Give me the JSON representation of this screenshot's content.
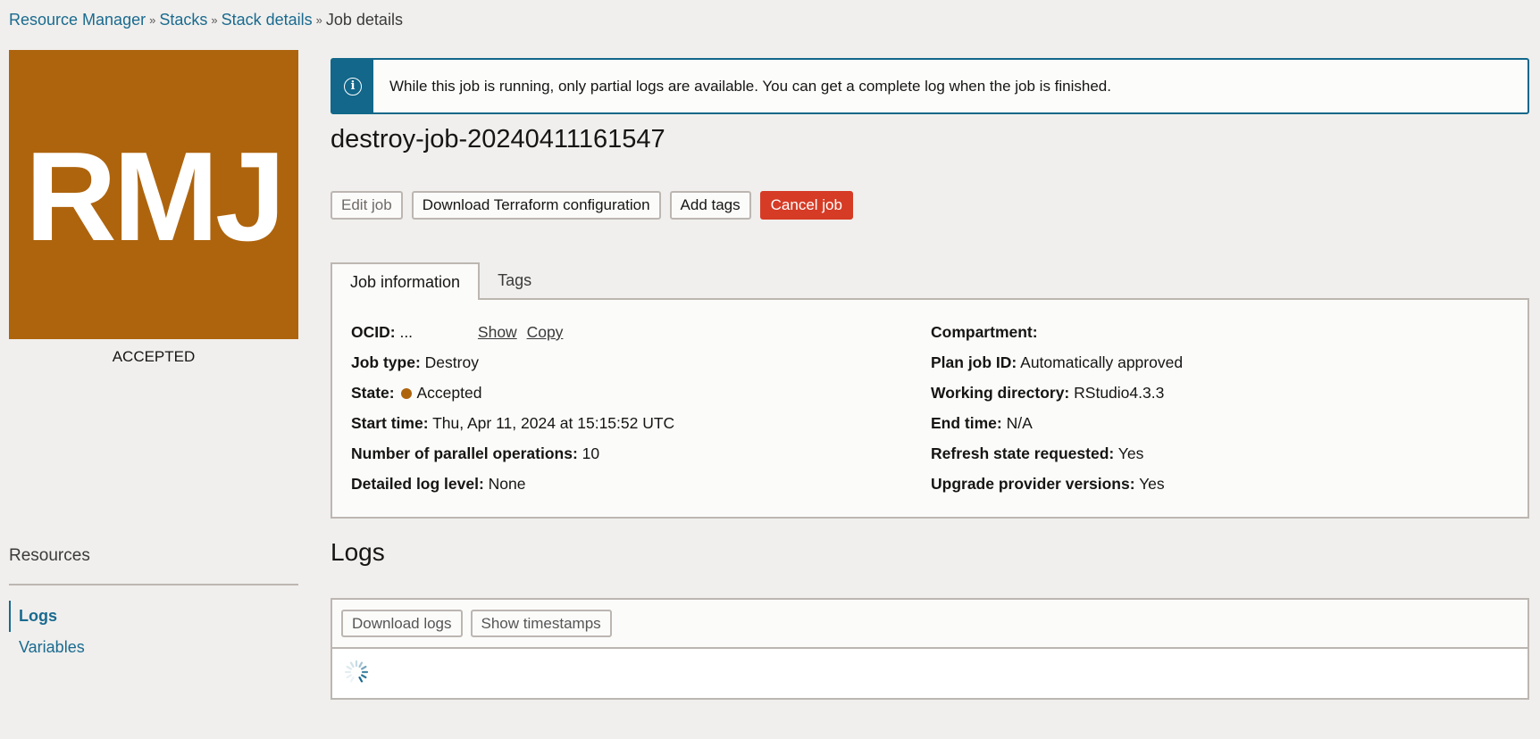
{
  "breadcrumb": [
    {
      "label": "Resource Manager",
      "link": true
    },
    {
      "label": "Stacks",
      "link": true
    },
    {
      "label": "Stack details",
      "link": true
    },
    {
      "label": "Job details",
      "link": false
    }
  ],
  "sidebar": {
    "avatar_initials": "RMJ",
    "avatar_color": "#ae640d",
    "status": "ACCEPTED",
    "resources_title": "Resources",
    "resources": [
      {
        "label": "Logs",
        "active": true
      },
      {
        "label": "Variables",
        "active": false
      }
    ]
  },
  "banner": {
    "icon": "info-icon",
    "text": "While this job is running, only partial logs are available. You can get a complete log when the job is finished."
  },
  "job": {
    "title": "destroy-job-20240411161547"
  },
  "actions": {
    "edit": "Edit job",
    "download_tf": "Download Terraform configuration",
    "add_tags": "Add tags",
    "cancel": "Cancel job"
  },
  "tabs": [
    {
      "label": "Job information",
      "active": true
    },
    {
      "label": "Tags",
      "active": false
    }
  ],
  "info": {
    "ocid": {
      "label": "OCID:",
      "value": "...",
      "show": "Show",
      "copy": "Copy"
    },
    "job_type": {
      "label": "Job type:",
      "value": "Destroy"
    },
    "state": {
      "label": "State:",
      "value": "Accepted",
      "color": "#ae640d"
    },
    "start_time": {
      "label": "Start time:",
      "value": "Thu, Apr 11, 2024 at 15:15:52 UTC"
    },
    "parallel_ops": {
      "label": "Number of parallel operations:",
      "value": "10"
    },
    "log_level": {
      "label": "Detailed log level:",
      "value": "None"
    },
    "compartment": {
      "label": "Compartment:",
      "value": ""
    },
    "plan_job_id": {
      "label": "Plan job ID:",
      "value": "Automatically approved"
    },
    "working_dir": {
      "label": "Working directory:",
      "value": "RStudio4.3.3"
    },
    "end_time": {
      "label": "End time:",
      "value": "N/A"
    },
    "refresh_state": {
      "label": "Refresh state requested:",
      "value": "Yes"
    },
    "upgrade_provider": {
      "label": "Upgrade provider versions:",
      "value": "Yes"
    }
  },
  "logs": {
    "title": "Logs",
    "download": "Download logs",
    "timestamps": "Show timestamps",
    "loading": true
  }
}
